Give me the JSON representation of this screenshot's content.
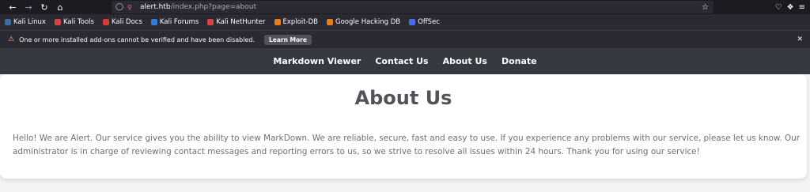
{
  "browser": {
    "url_host": "alert.htb",
    "url_path": "/index.php?page=about",
    "bookmarks": [
      {
        "label": "Kali Linux",
        "icon": "kali-icon",
        "color": "#3a6ea5"
      },
      {
        "label": "Kali Tools",
        "icon": "kali-tools-icon",
        "color": "#d64545"
      },
      {
        "label": "Kali Docs",
        "icon": "kali-docs-icon",
        "color": "#d63c3c"
      },
      {
        "label": "Kali Forums",
        "icon": "kali-forums-icon",
        "color": "#367bd6"
      },
      {
        "label": "Kali NetHunter",
        "icon": "nethunter-icon",
        "color": "#d94343"
      },
      {
        "label": "Exploit-DB",
        "icon": "exploit-db-icon",
        "color": "#e67e22"
      },
      {
        "label": "Google Hacking DB",
        "icon": "ghdb-icon",
        "color": "#e67e22"
      },
      {
        "label": "OffSec",
        "icon": "offsec-icon",
        "color": "#4a6fe3"
      }
    ],
    "notification": {
      "message": "One or more installed add-ons cannot be verified and have been disabled.",
      "learn_more": "Learn More"
    }
  },
  "site": {
    "nav": [
      "Markdown Viewer",
      "Contact Us",
      "About Us",
      "Donate"
    ],
    "title": "About Us",
    "body": "Hello! We are Alert. Our service gives you the ability to view MarkDown. We are reliable, secure, fast and easy to use. If you experience any problems with our service, please let us know. Our administrator is in charge of reviewing contact messages and reporting errors to us, so we strive to resolve all issues within 24 hours. Thank you for using our service!"
  }
}
